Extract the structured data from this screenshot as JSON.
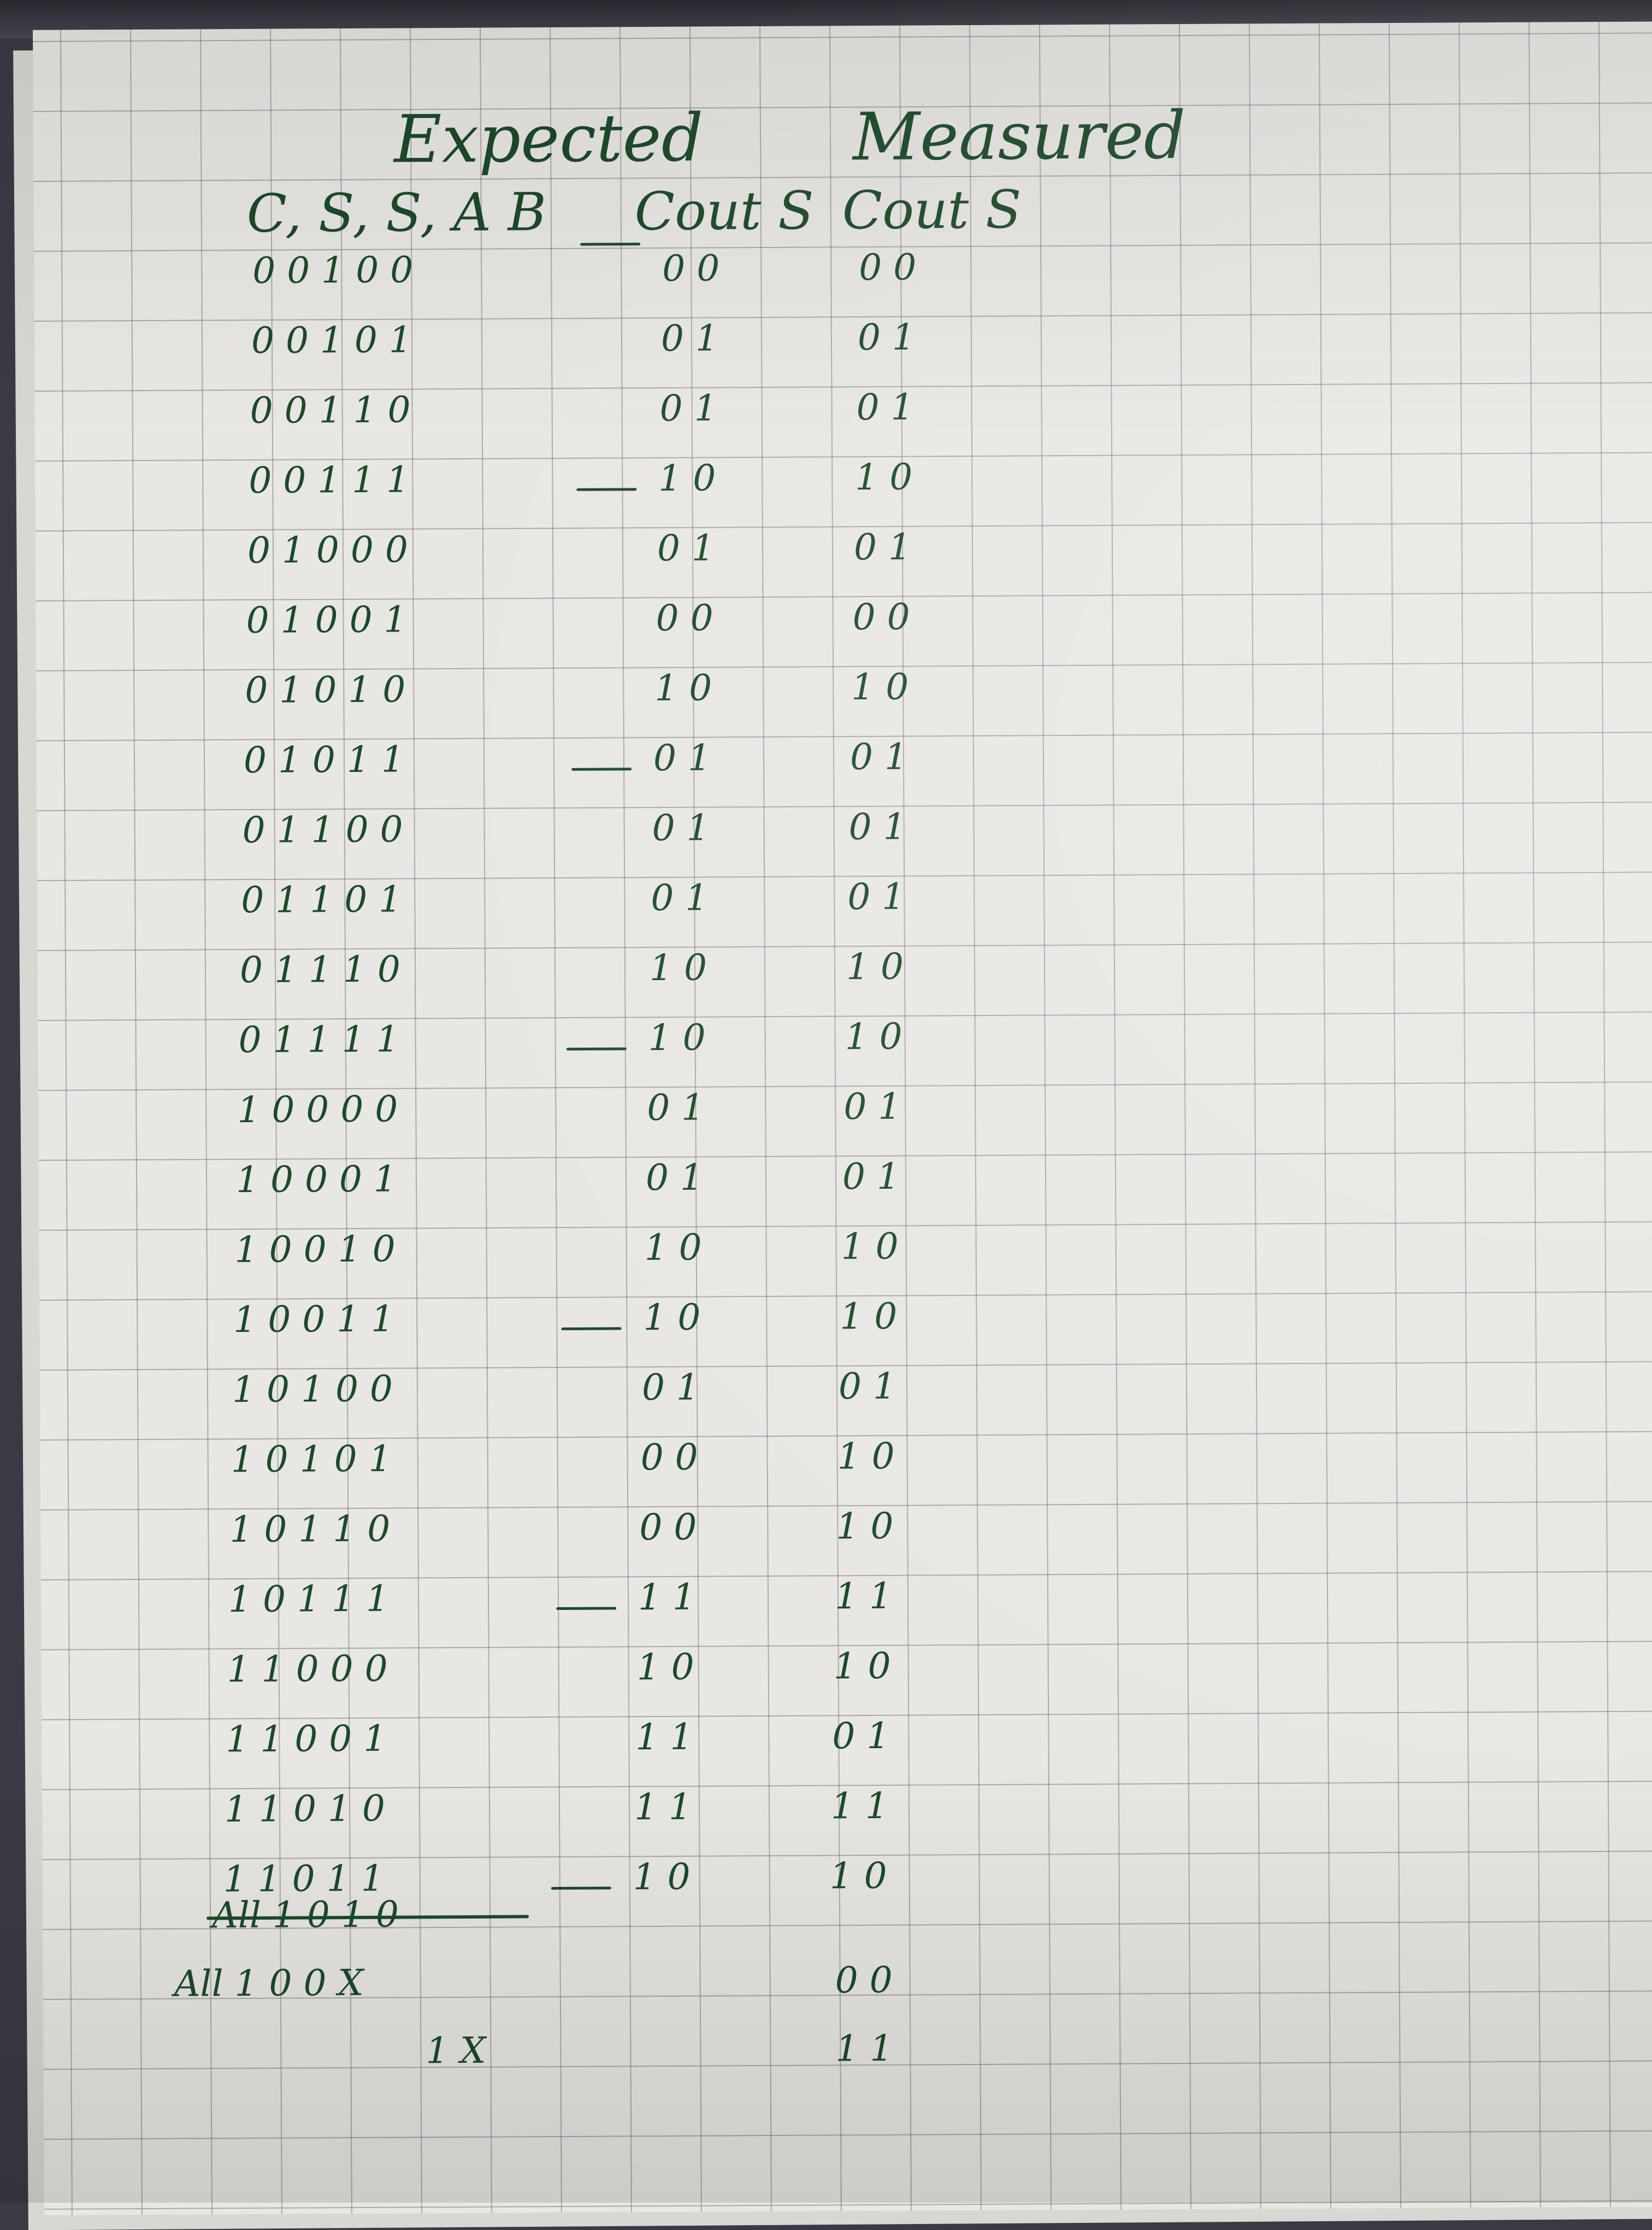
{
  "headings": {
    "expected": "Expected",
    "measured": "Measured"
  },
  "column_labels": {
    "inputs": "C, S, S, A B",
    "expected_outputs": "Cout S",
    "measured_outputs": "Cout S"
  },
  "rows": [
    {
      "inputs": "0 0 1 0 0",
      "expected": "0 0",
      "measured": "0 0",
      "dash": false
    },
    {
      "inputs": "0 0 1 0 1",
      "expected": "0 1",
      "measured": "0 1",
      "dash": false
    },
    {
      "inputs": "0 0 1 1 0",
      "expected": "0 1",
      "measured": "0 1",
      "dash": false
    },
    {
      "inputs": "0 0 1 1 1",
      "expected": "1 0",
      "measured": "1 0",
      "dash": true
    },
    {
      "inputs": "0 1 0 0 0",
      "expected": "0 1",
      "measured": "0 1",
      "dash": false
    },
    {
      "inputs": "0 1 0 0 1",
      "expected": "0 0",
      "measured": "0 0",
      "dash": false
    },
    {
      "inputs": "0 1 0 1 0",
      "expected": "1 0",
      "measured": "1 0",
      "dash": false
    },
    {
      "inputs": "0 1 0 1 1",
      "expected": "0 1",
      "measured": "0 1",
      "dash": true
    },
    {
      "inputs": "0 1 1 0 0",
      "expected": "0 1",
      "measured": "0 1",
      "dash": false
    },
    {
      "inputs": "0 1 1 0 1",
      "expected": "0 1",
      "measured": "0 1",
      "dash": false
    },
    {
      "inputs": "0 1 1 1 0",
      "expected": "1 0",
      "measured": "1 0",
      "dash": false
    },
    {
      "inputs": "0 1 1 1 1",
      "expected": "1 0",
      "measured": "1 0",
      "dash": true
    },
    {
      "inputs": "1 0 0 0 0",
      "expected": "0 1",
      "measured": "0 1",
      "dash": false
    },
    {
      "inputs": "1 0 0 0 1",
      "expected": "0 1",
      "measured": "0 1",
      "dash": false
    },
    {
      "inputs": "1 0 0 1 0",
      "expected": "1 0",
      "measured": "1 0",
      "dash": false
    },
    {
      "inputs": "1 0 0 1 1",
      "expected": "1 0",
      "measured": "1 0",
      "dash": true
    },
    {
      "inputs": "1 0 1 0 0",
      "expected": "0 1",
      "measured": "0 1",
      "dash": false
    },
    {
      "inputs": "1 0 1 0 1",
      "expected": "0 0",
      "measured": "1 0",
      "dash": false
    },
    {
      "inputs": "1 0 1 1 0",
      "expected": "0 0",
      "measured": "1 0",
      "dash": false
    },
    {
      "inputs": "1 0 1 1 1",
      "expected": "1 1",
      "measured": "1 1",
      "dash": true
    },
    {
      "inputs": "1 1 0 0 0",
      "expected": "1 0",
      "measured": "1 0",
      "dash": false
    },
    {
      "inputs": "1 1 0 0 1",
      "expected": "1 1",
      "measured": "0 1",
      "dash": false
    },
    {
      "inputs": "1 1 0 1 0",
      "expected": "1 1",
      "measured": "1 1",
      "dash": false
    },
    {
      "inputs": "1 1 0 1 1",
      "expected": "1 0",
      "measured": "1 0",
      "dash": true
    }
  ],
  "crossed_row": "All 1 0 1 0",
  "extra_rows": [
    {
      "inputs": "All 1 0 0 X",
      "measured": "0 0"
    },
    {
      "inputs": "1 X",
      "measured": "1 1"
    }
  ],
  "ink_color": "#1c4a2a"
}
